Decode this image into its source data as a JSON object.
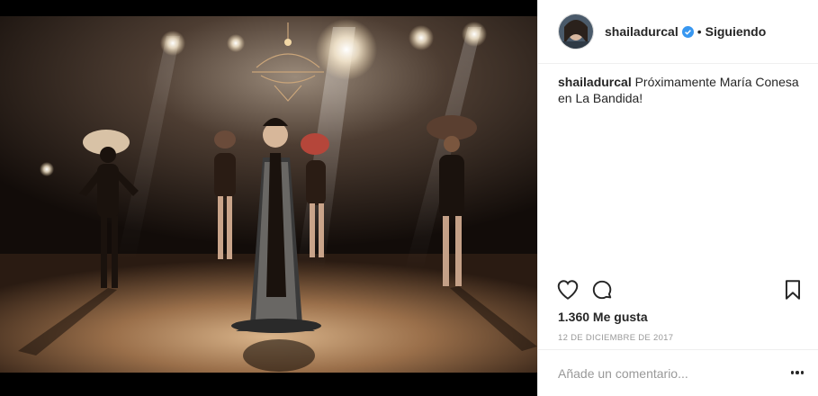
{
  "post": {
    "username": "shailadurcal",
    "verified": true,
    "separator": "•",
    "follow_status": "Siguiendo",
    "caption_user": "shailadurcal",
    "caption_text": "Próximamente María Conesa en La Bandida!",
    "likes": "1.360 Me gusta",
    "date": "12 DE DICIEMBRE DE 2017",
    "comment_placeholder": "Añade un comentario...",
    "media_description": "stage-performance-photo"
  },
  "icons": {
    "like": "heart-outline-icon",
    "comment": "speech-bubble-icon",
    "save": "bookmark-icon",
    "verified": "verified-badge-icon",
    "more": "more-options-icon"
  },
  "colors": {
    "verified_blue": "#3897f0",
    "text": "#262626",
    "muted": "#999999",
    "divider": "#efefef"
  }
}
